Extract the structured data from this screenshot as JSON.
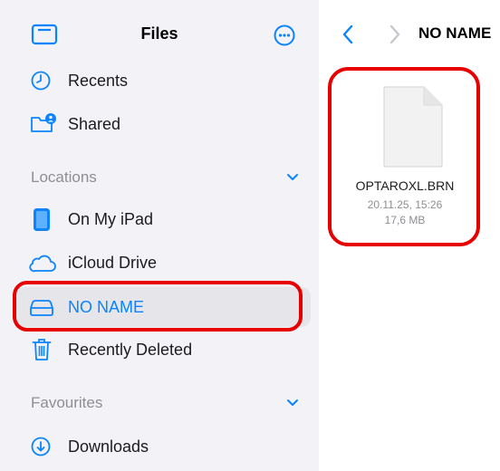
{
  "sidebar": {
    "title": "Files",
    "items_top": [
      {
        "label": "Recents",
        "icon": "clock-icon"
      },
      {
        "label": "Shared",
        "icon": "shared-folder-icon"
      }
    ],
    "locations": {
      "title": "Locations",
      "items": [
        {
          "label": "On My iPad",
          "icon": "ipad-icon"
        },
        {
          "label": "iCloud Drive",
          "icon": "cloud-icon"
        },
        {
          "label": "NO NAME",
          "icon": "external-drive-icon",
          "selected": true
        },
        {
          "label": "Recently Deleted",
          "icon": "trash-icon"
        }
      ]
    },
    "favourites": {
      "title": "Favourites",
      "items": [
        {
          "label": "Downloads",
          "icon": "download-icon"
        }
      ]
    }
  },
  "detail": {
    "breadcrumb": "NO NAME",
    "file": {
      "name": "OPTAROXL.BRN",
      "date": "20.11.25, 15:26",
      "size": "17,6 MB"
    }
  },
  "colors": {
    "accent": "#0a84ff",
    "sidebar_bg": "#f2f2f7",
    "selection_bg": "#e5e5ea",
    "highlight_red": "#e60000",
    "secondary_text": "#8e8e93"
  }
}
